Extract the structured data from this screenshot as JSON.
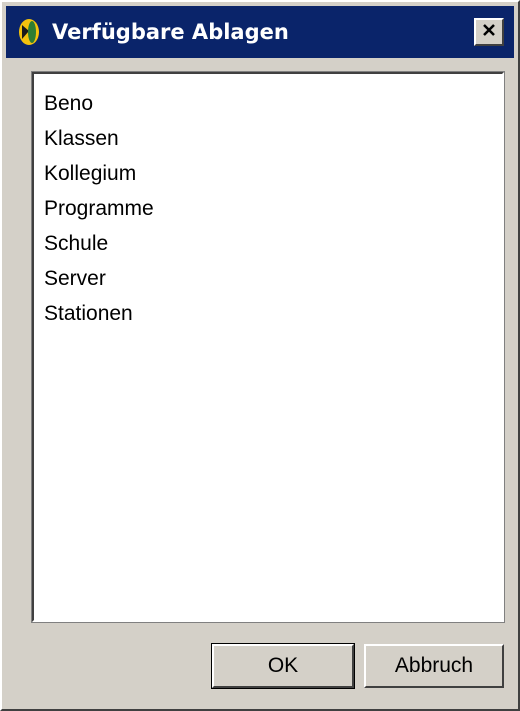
{
  "window": {
    "title": "Verfügbare Ablagen",
    "app_icon": "folder-share-icon",
    "close_icon": "close-icon"
  },
  "list": {
    "items": [
      "Beno",
      "Klassen",
      "Kollegium",
      "Programme",
      "Schule",
      "Server",
      "Stationen"
    ]
  },
  "buttons": {
    "ok_label": "OK",
    "cancel_label": "Abbruch"
  },
  "colors": {
    "titlebar": "#0a246a",
    "dialog_face": "#d4d0c8",
    "list_background": "#ffffff"
  }
}
